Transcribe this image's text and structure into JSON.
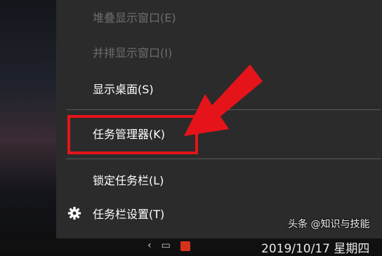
{
  "context_menu": {
    "items": [
      {
        "label": "堆叠显示窗口(E)",
        "enabled": false
      },
      {
        "label": "并排显示窗口(I)",
        "enabled": false
      },
      {
        "label": "显示桌面(S)",
        "enabled": true
      },
      {
        "label": "任务管理器(K)",
        "enabled": true,
        "highlighted": true
      },
      {
        "label": "锁定任务栏(L)",
        "enabled": true
      },
      {
        "label": "任务栏设置(T)",
        "enabled": true,
        "icon": "gear-icon"
      }
    ]
  },
  "annotation": {
    "color": "#e5141a",
    "target": "任务管理器(K)"
  },
  "taskbar": {
    "clock_date": "2019/10/17 星期四"
  },
  "watermark": {
    "text": "头条 @知识与技能"
  }
}
